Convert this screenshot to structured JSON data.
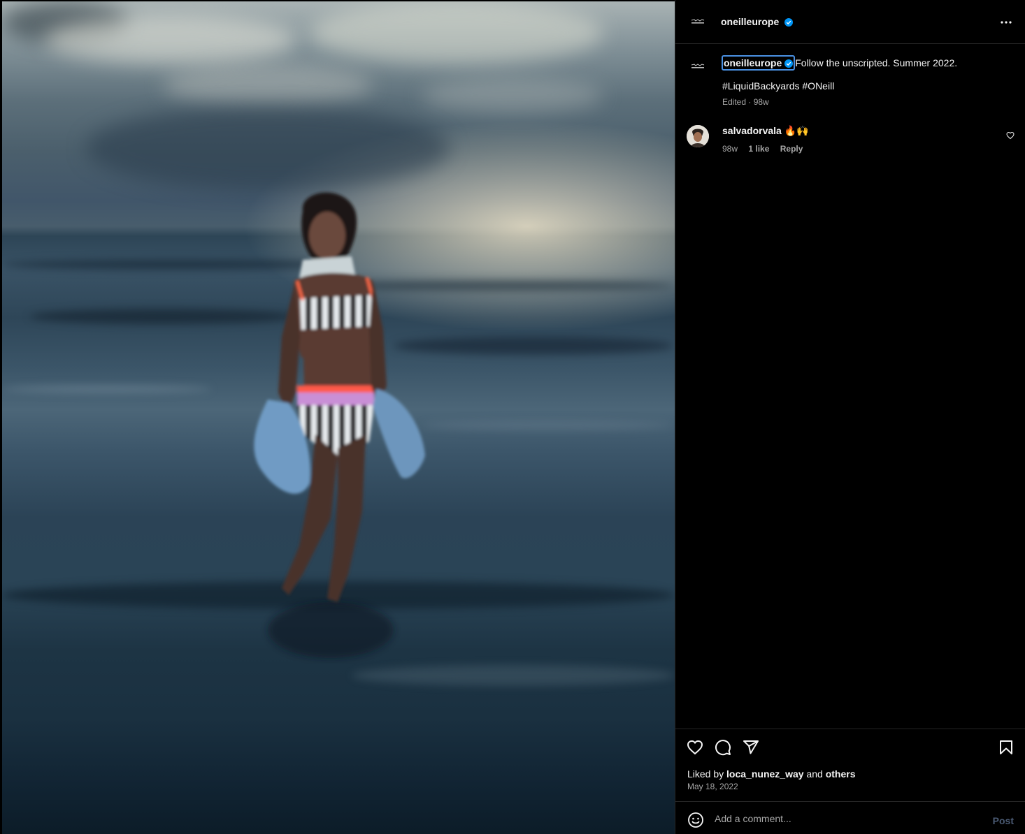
{
  "post": {
    "username": "oneilleurope",
    "caption_text": "Follow the unscripted. Summer 2022.",
    "hashtags": "#LiquidBackyards #ONeill",
    "edited_meta": "Edited · 98w",
    "photo_alt": "Woman walking in the sea at dusk"
  },
  "comments": [
    {
      "username": "salvadorvala",
      "text": "🔥🙌",
      "age": "98w",
      "likes": "1 like",
      "reply_label": "Reply"
    }
  ],
  "actions": {
    "liked_by_prefix": "Liked by ",
    "liked_by_user": "loca_nunez_way",
    "liked_by_middle": " and ",
    "liked_by_others": "others",
    "date": "May 18, 2022"
  },
  "composer": {
    "placeholder": "Add a comment...",
    "post_label": "Post"
  },
  "colors": {
    "background": "#000000",
    "divider": "#262626",
    "verified_blue": "#0095f6",
    "secondary_text": "#a8a8a8",
    "post_button_disabled": "#4a5a73"
  },
  "icons": [
    "more-icon",
    "verified-badge-icon",
    "heart-icon",
    "comment-icon",
    "share-icon",
    "bookmark-icon",
    "emoji-icon",
    "small-heart-icon"
  ]
}
